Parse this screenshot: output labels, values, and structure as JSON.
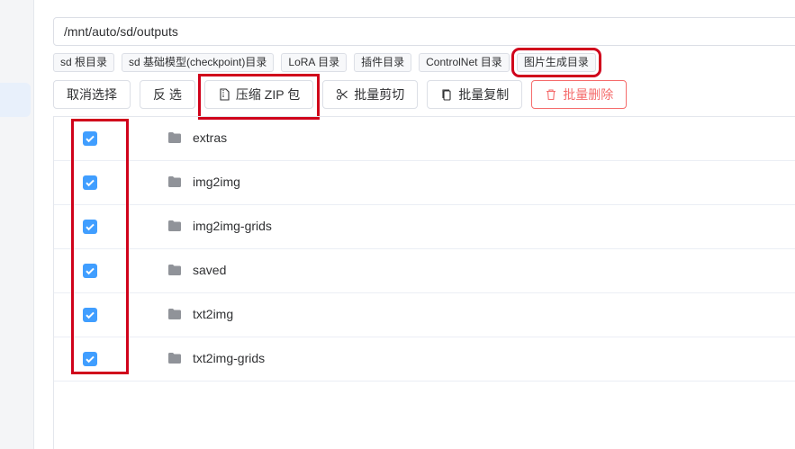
{
  "path_input": {
    "value": "/mnt/auto/sd/outputs"
  },
  "quick_dirs": [
    {
      "label": "sd 根目录"
    },
    {
      "label": "sd 基础模型(checkpoint)目录"
    },
    {
      "label": "LoRA 目录"
    },
    {
      "label": "插件目录"
    },
    {
      "label": "ControlNet 目录"
    },
    {
      "label": "图片生成目录",
      "highlighted": true
    }
  ],
  "toolbar": {
    "deselect": "取消选择",
    "invert": "反 选",
    "zip": "压缩 ZIP 包",
    "cut": "批量剪切",
    "copy": "批量复制",
    "delete": "批量删除"
  },
  "files": [
    {
      "name": "extras",
      "checked": true
    },
    {
      "name": "img2img",
      "checked": true
    },
    {
      "name": "img2img-grids",
      "checked": true
    },
    {
      "name": "saved",
      "checked": true
    },
    {
      "name": "txt2img",
      "checked": true
    },
    {
      "name": "txt2img-grids",
      "checked": true
    }
  ],
  "icons": {
    "zip": "archive-file-icon",
    "cut": "scissors-icon",
    "copy": "copy-icon",
    "delete": "trash-icon",
    "folder": "folder-icon",
    "checkbox": "checkbox-checked-icon"
  },
  "colors": {
    "accent": "#409eff",
    "danger": "#f56c6c",
    "annotation": "#d0021b",
    "folder": "#909399"
  }
}
